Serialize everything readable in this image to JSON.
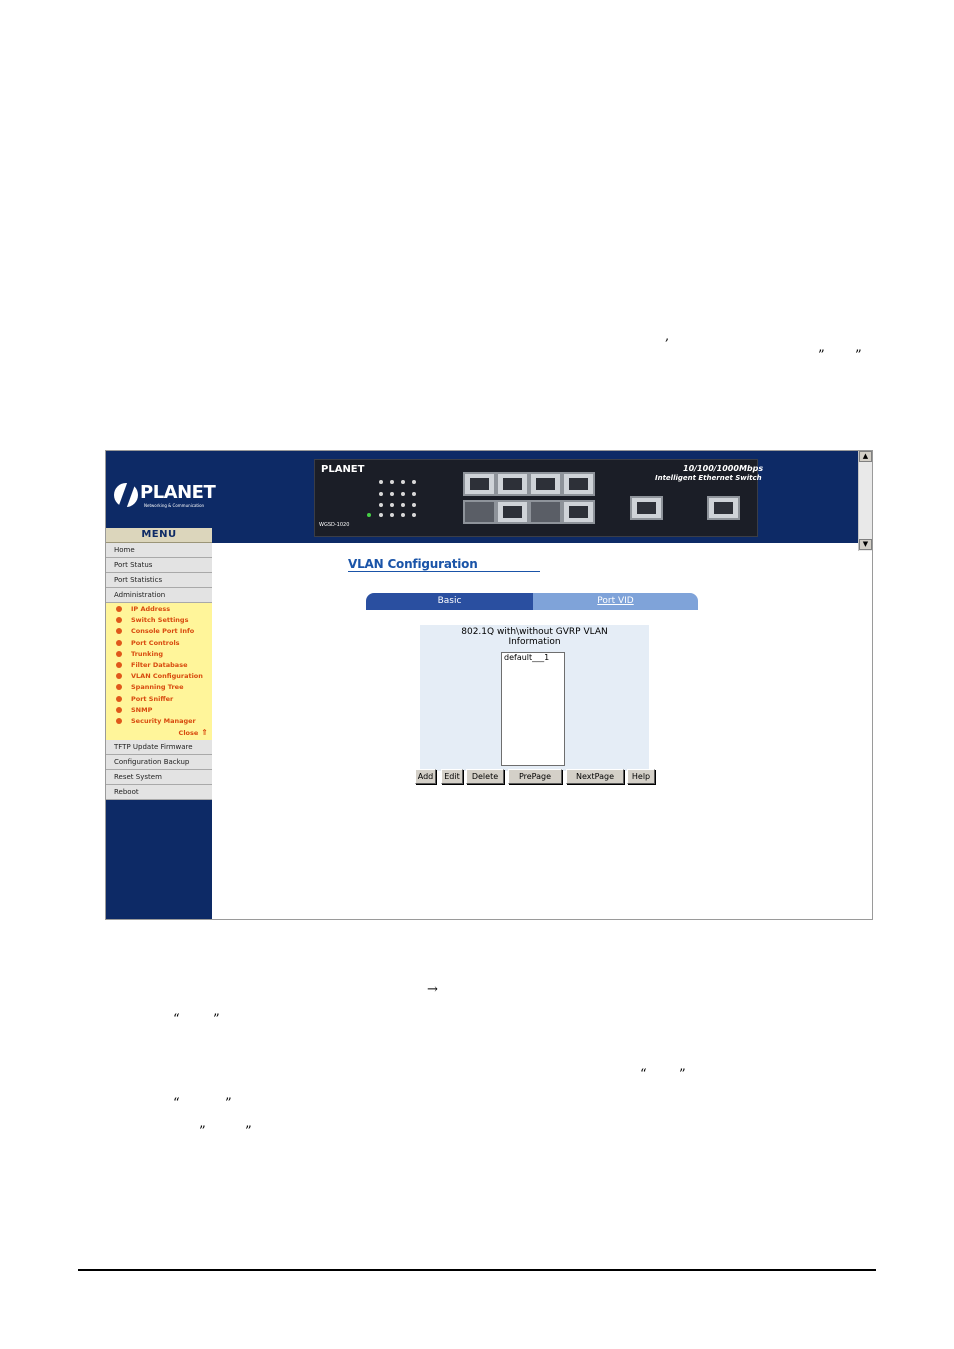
{
  "doc": {
    "stray_marks": [
      ",",
      "”",
      "”",
      "→",
      "“",
      "”",
      "“",
      "”",
      "“",
      "”",
      "”",
      "”"
    ]
  },
  "banner": {
    "logo_text": "PLANET",
    "logo_sub": "Networking & Communication",
    "switch_brand": "PLANET",
    "switch_title": "10/100/1000Mbps",
    "switch_subtitle": "Intelligent Ethernet Switch",
    "switch_model": "WGSD-1020"
  },
  "menu": {
    "header": "MENU",
    "top_items": [
      "Home",
      "Port Status",
      "Port Statistics",
      "Administration"
    ],
    "admin_items": [
      "IP Address",
      "Switch Settings",
      "Console Port Info",
      "Port Controls",
      "Trunking",
      "Filter Database",
      "VLAN Configuration",
      "Spanning Tree",
      "Port Sniffer",
      "SNMP",
      "Security Manager"
    ],
    "close_label": "Close",
    "bottom_items": [
      "TFTP Update Firmware",
      "Configuration Backup",
      "Reset System",
      "Reboot"
    ]
  },
  "main": {
    "title": "VLAN Configuration",
    "tabs": [
      {
        "label": "Basic",
        "selected": true
      },
      {
        "label": "Port VID",
        "selected": false
      }
    ],
    "panel_title_line1": "802.1Q with\\without GVRP VLAN",
    "panel_title_line2": "Information",
    "vlan_list": [
      "default___1"
    ],
    "buttons": [
      "Add",
      "Edit",
      "Delete",
      "PrePage",
      "NextPage",
      "Help"
    ]
  },
  "colors": {
    "navy": "#0d2a66",
    "submenu_bg": "#fff59a",
    "submenu_text": "#d84a0e",
    "title_blue": "#1a54a8"
  }
}
